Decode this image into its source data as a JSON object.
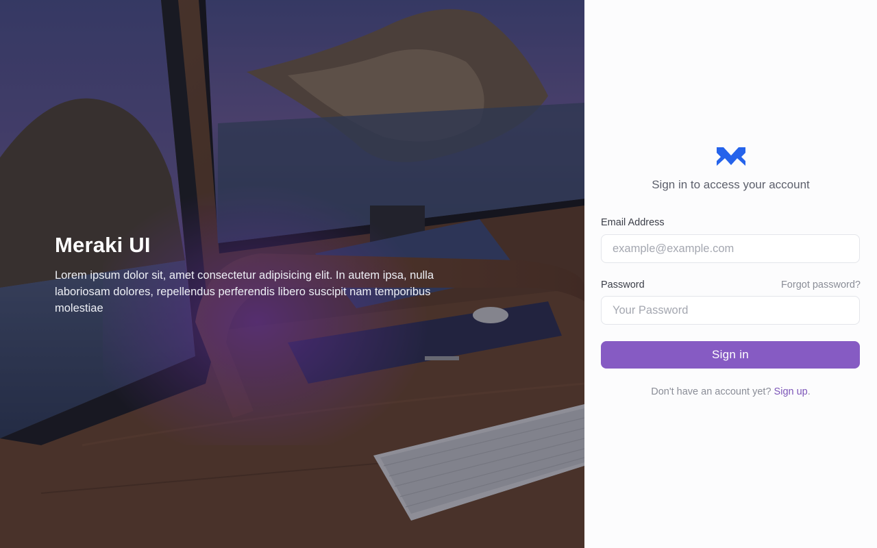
{
  "hero": {
    "title": "Meraki UI",
    "description": "Lorem ipsum dolor sit, amet consectetur adipisicing elit. In autem ipsa, nulla laboriosam dolores, repellendus perferendis libero suscipit nam temporibus molestiae"
  },
  "form": {
    "logo_icon": "meraki-m-logo-icon",
    "subtitle": "Sign in to access your account",
    "email": {
      "label": "Email Address",
      "placeholder": "example@example.com",
      "value": ""
    },
    "password": {
      "label": "Password",
      "placeholder": "Your Password",
      "value": "",
      "forgot_label": "Forgot password?"
    },
    "submit_label": "Sign in",
    "signup_prompt": "Don't have an account yet?",
    "signup_link": "Sign up",
    "signup_suffix": "."
  },
  "colors": {
    "accent": "#865bc3",
    "link": "#7c55b8",
    "logo": "#2563eb",
    "panel_bg": "#fcfcfd"
  }
}
